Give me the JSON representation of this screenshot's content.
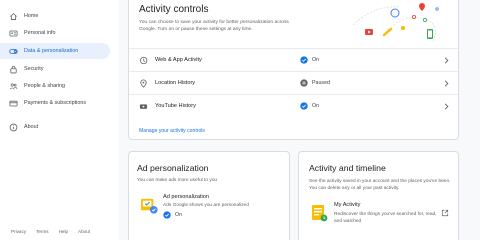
{
  "sidebar": {
    "items": [
      {
        "label": "Home",
        "icon": "home-icon",
        "active": false
      },
      {
        "label": "Personal info",
        "icon": "id-card-icon",
        "active": false
      },
      {
        "label": "Data & personalization",
        "icon": "toggle-icon",
        "active": true
      },
      {
        "label": "Security",
        "icon": "lock-icon",
        "active": false
      },
      {
        "label": "People & sharing",
        "icon": "people-icon",
        "active": false
      },
      {
        "label": "Payments & subscriptions",
        "icon": "credit-card-icon",
        "active": false
      },
      {
        "label": "About",
        "icon": "info-icon",
        "active": false
      }
    ],
    "footer": [
      "Privacy",
      "Terms",
      "Help",
      "About"
    ]
  },
  "activity_controls": {
    "title": "Activity controls",
    "description": "You can choose to save your activity for better personalization across Google. Turn on or pause these settings at any time.",
    "rows": [
      {
        "label": "Web & App Activity",
        "status": "On",
        "icon": "history-icon",
        "status_icon": "check-circle-icon"
      },
      {
        "label": "Location History",
        "status": "Paused",
        "icon": "location-pin-icon",
        "status_icon": "paused-circle-icon"
      },
      {
        "label": "YouTube History",
        "status": "On",
        "icon": "youtube-icon",
        "status_icon": "check-circle-icon"
      }
    ],
    "manage_link": "Manage your activity controls"
  },
  "ad_personalization": {
    "title": "Ad personalization",
    "description": "You can make ads more useful to you",
    "sub_title": "Ad personalization",
    "sub_description": "Ads Google shows you are personalized",
    "status": "On"
  },
  "timeline": {
    "title": "Activity and timeline",
    "description": "See the activity saved in your account and the places you've been. You can delete any or all your past activity.",
    "sub_title": "My Activity",
    "sub_description": "Rediscover the things you've searched for, read, and watched"
  },
  "colors": {
    "accent": "#1a73e8",
    "active_bg": "#e8f0fe",
    "paused": "#5f6368"
  }
}
